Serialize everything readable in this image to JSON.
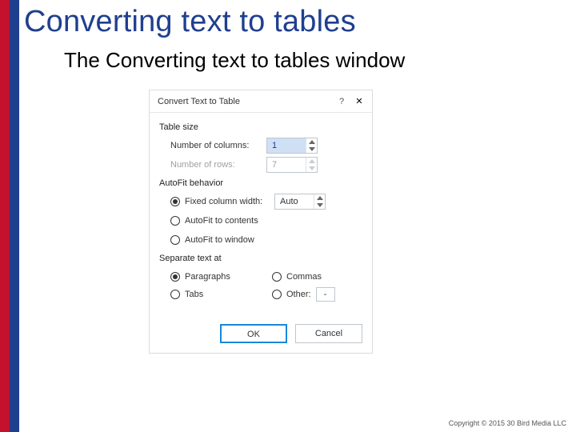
{
  "title": "Converting text to tables",
  "subtitle": "The Converting text to tables window",
  "copyright": "Copyright © 2015 30 Bird Media LLC",
  "dialog": {
    "title": "Convert Text to Table",
    "help": "?",
    "close": "✕",
    "groups": {
      "tablesize": {
        "label": "Table size",
        "cols_label": "Number of columns:",
        "cols_value": "1",
        "rows_label": "Number of rows:",
        "rows_value": "7"
      },
      "autofit": {
        "label": "AutoFit behavior",
        "fixed_label": "Fixed column width:",
        "fixed_value": "Auto",
        "contents_label": "AutoFit to contents",
        "window_label": "AutoFit to window"
      },
      "separate": {
        "label": "Separate text at",
        "paragraphs": "Paragraphs",
        "commas": "Commas",
        "tabs": "Tabs",
        "other": "Other:",
        "other_value": "-"
      }
    },
    "ok": "OK",
    "cancel": "Cancel"
  }
}
